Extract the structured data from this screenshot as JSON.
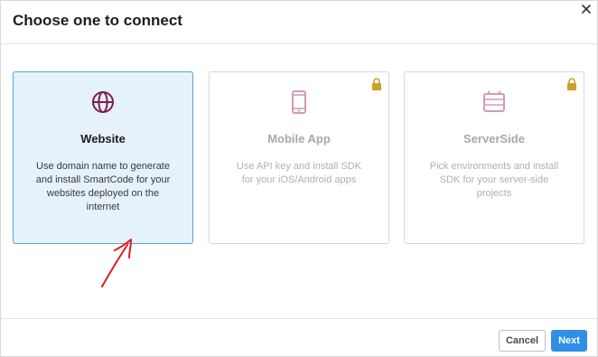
{
  "dialog": {
    "title": "Choose one to connect",
    "close_icon": "close-icon"
  },
  "cards": [
    {
      "title": "Website",
      "description": "Use domain name to generate and install SmartCode for your websites deployed on the internet",
      "icon": "globe-icon",
      "state": "selected"
    },
    {
      "title": "Mobile App",
      "description": "Use API key and install SDK for your iOS/Android apps",
      "icon": "mobile-phone-icon",
      "state": "locked"
    },
    {
      "title": "ServerSide",
      "description": "Pick environments and install SDK for your server-side projects",
      "icon": "server-icon",
      "state": "locked"
    }
  ],
  "footer": {
    "cancel_label": "Cancel",
    "next_label": "Next"
  },
  "colors": {
    "accent": "#2f8fe6",
    "selected_bg": "#e5f1fb",
    "icon_active": "#7a1f4a",
    "icon_disabled": "#d59ab5",
    "lock": "#c9a227",
    "annotation": "#e01b1b"
  }
}
